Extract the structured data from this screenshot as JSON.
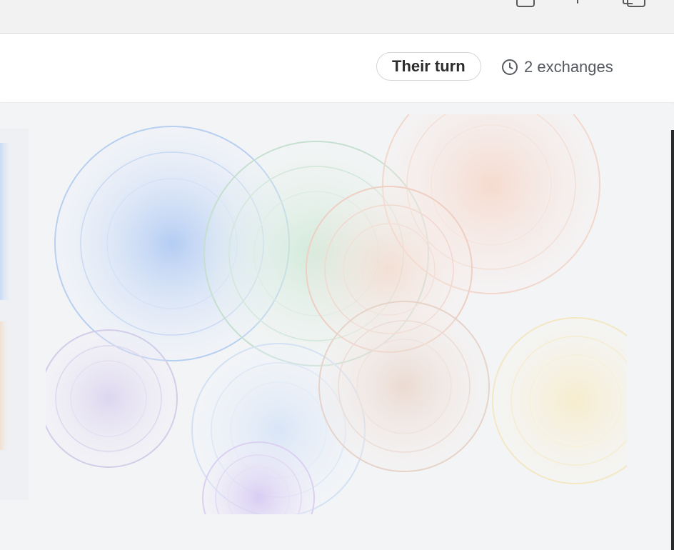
{
  "window": {
    "toolbar_icons": [
      "window-icon",
      "share-icon",
      "copy-icon"
    ]
  },
  "header": {
    "turn_label": "Their turn",
    "exchanges_label": "2 exchanges",
    "clock_icon": "clock-icon"
  },
  "artwork": {
    "description_colors": {
      "blue": "#8fb4ee",
      "green": "#b7dcc4",
      "peach": "#f2c4b0",
      "lavender": "#c8c0e6",
      "light_blue": "#cfdff5",
      "tan": "#e2c4b4",
      "yellow": "#f4e2b0",
      "violet": "#c9b6f0"
    }
  }
}
